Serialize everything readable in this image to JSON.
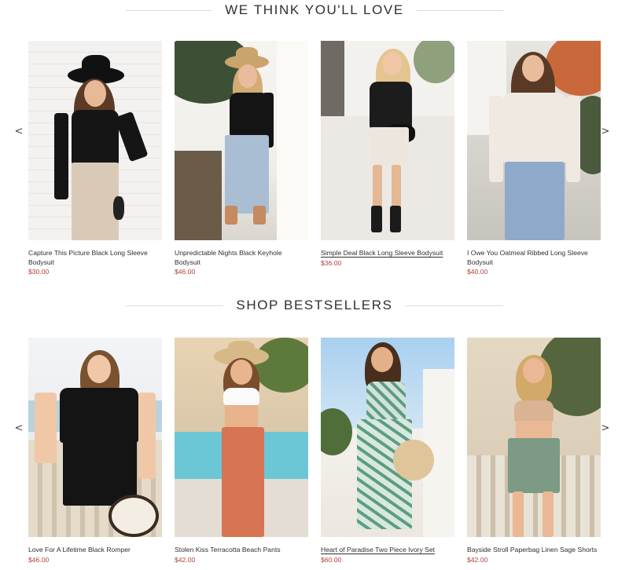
{
  "sections": [
    {
      "title": "WE THINK YOU'LL LOVE",
      "prev_arrow": "<",
      "next_arrow": ">",
      "products": [
        {
          "name": "Capture This Picture Black Long Sleeve Bodysuit",
          "price": "$30.00"
        },
        {
          "name": "Unpredictable Nights Black Keyhole Bodysuit",
          "price": "$46.00"
        },
        {
          "name": "Simple Deal Black Long Sleeve Bodysuit",
          "price": "$36.00"
        },
        {
          "name": "I Owe You Oatmeal Ribbed Long Sleeve Bodysuit",
          "price": "$40.00"
        }
      ]
    },
    {
      "title": "SHOP BESTSELLERS",
      "prev_arrow": "<",
      "next_arrow": ">",
      "products": [
        {
          "name": "Love For A Lifetime Black Romper",
          "price": "$46.00"
        },
        {
          "name": "Stolen Kiss Terracotta Beach Pants",
          "price": "$42.00"
        },
        {
          "name": "Heart of Paradise Two Piece Ivory Set",
          "price": "$60.00"
        },
        {
          "name": "Bayside Stroll Paperbag Linen Sage Shorts",
          "price": "$42.00"
        }
      ]
    }
  ],
  "colors": {
    "price": "#b0413e",
    "text": "#2f2f2f",
    "divider": "#dcdcdc"
  },
  "icons": {
    "prev": "chevron-left-icon",
    "next": "chevron-right-icon"
  }
}
